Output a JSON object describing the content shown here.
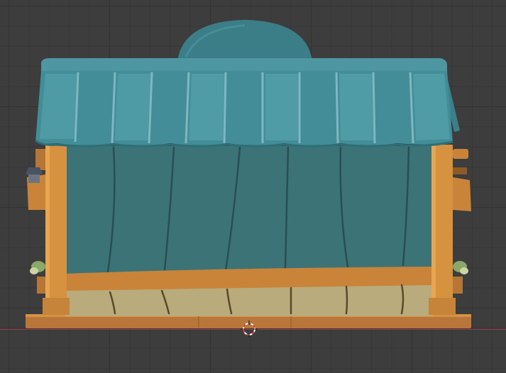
{
  "viewport": {
    "background": "#3d3d3d",
    "grid_major": "#333333",
    "grid_minor": "#373737",
    "x_axis_color": "#9a3a44"
  },
  "model": {
    "type": "market-stall",
    "roof_color": "#3f8a96",
    "roof_highlight": "#5aa7b2",
    "wall_color": "#3b7377",
    "wood_color": "#d6923f",
    "wood_dark": "#a86a2a",
    "floor_color": "#b8a97a"
  },
  "cursor": {
    "icon": "3d-cursor-icon",
    "color_a": "#ffffff",
    "color_b": "#d9433a"
  }
}
